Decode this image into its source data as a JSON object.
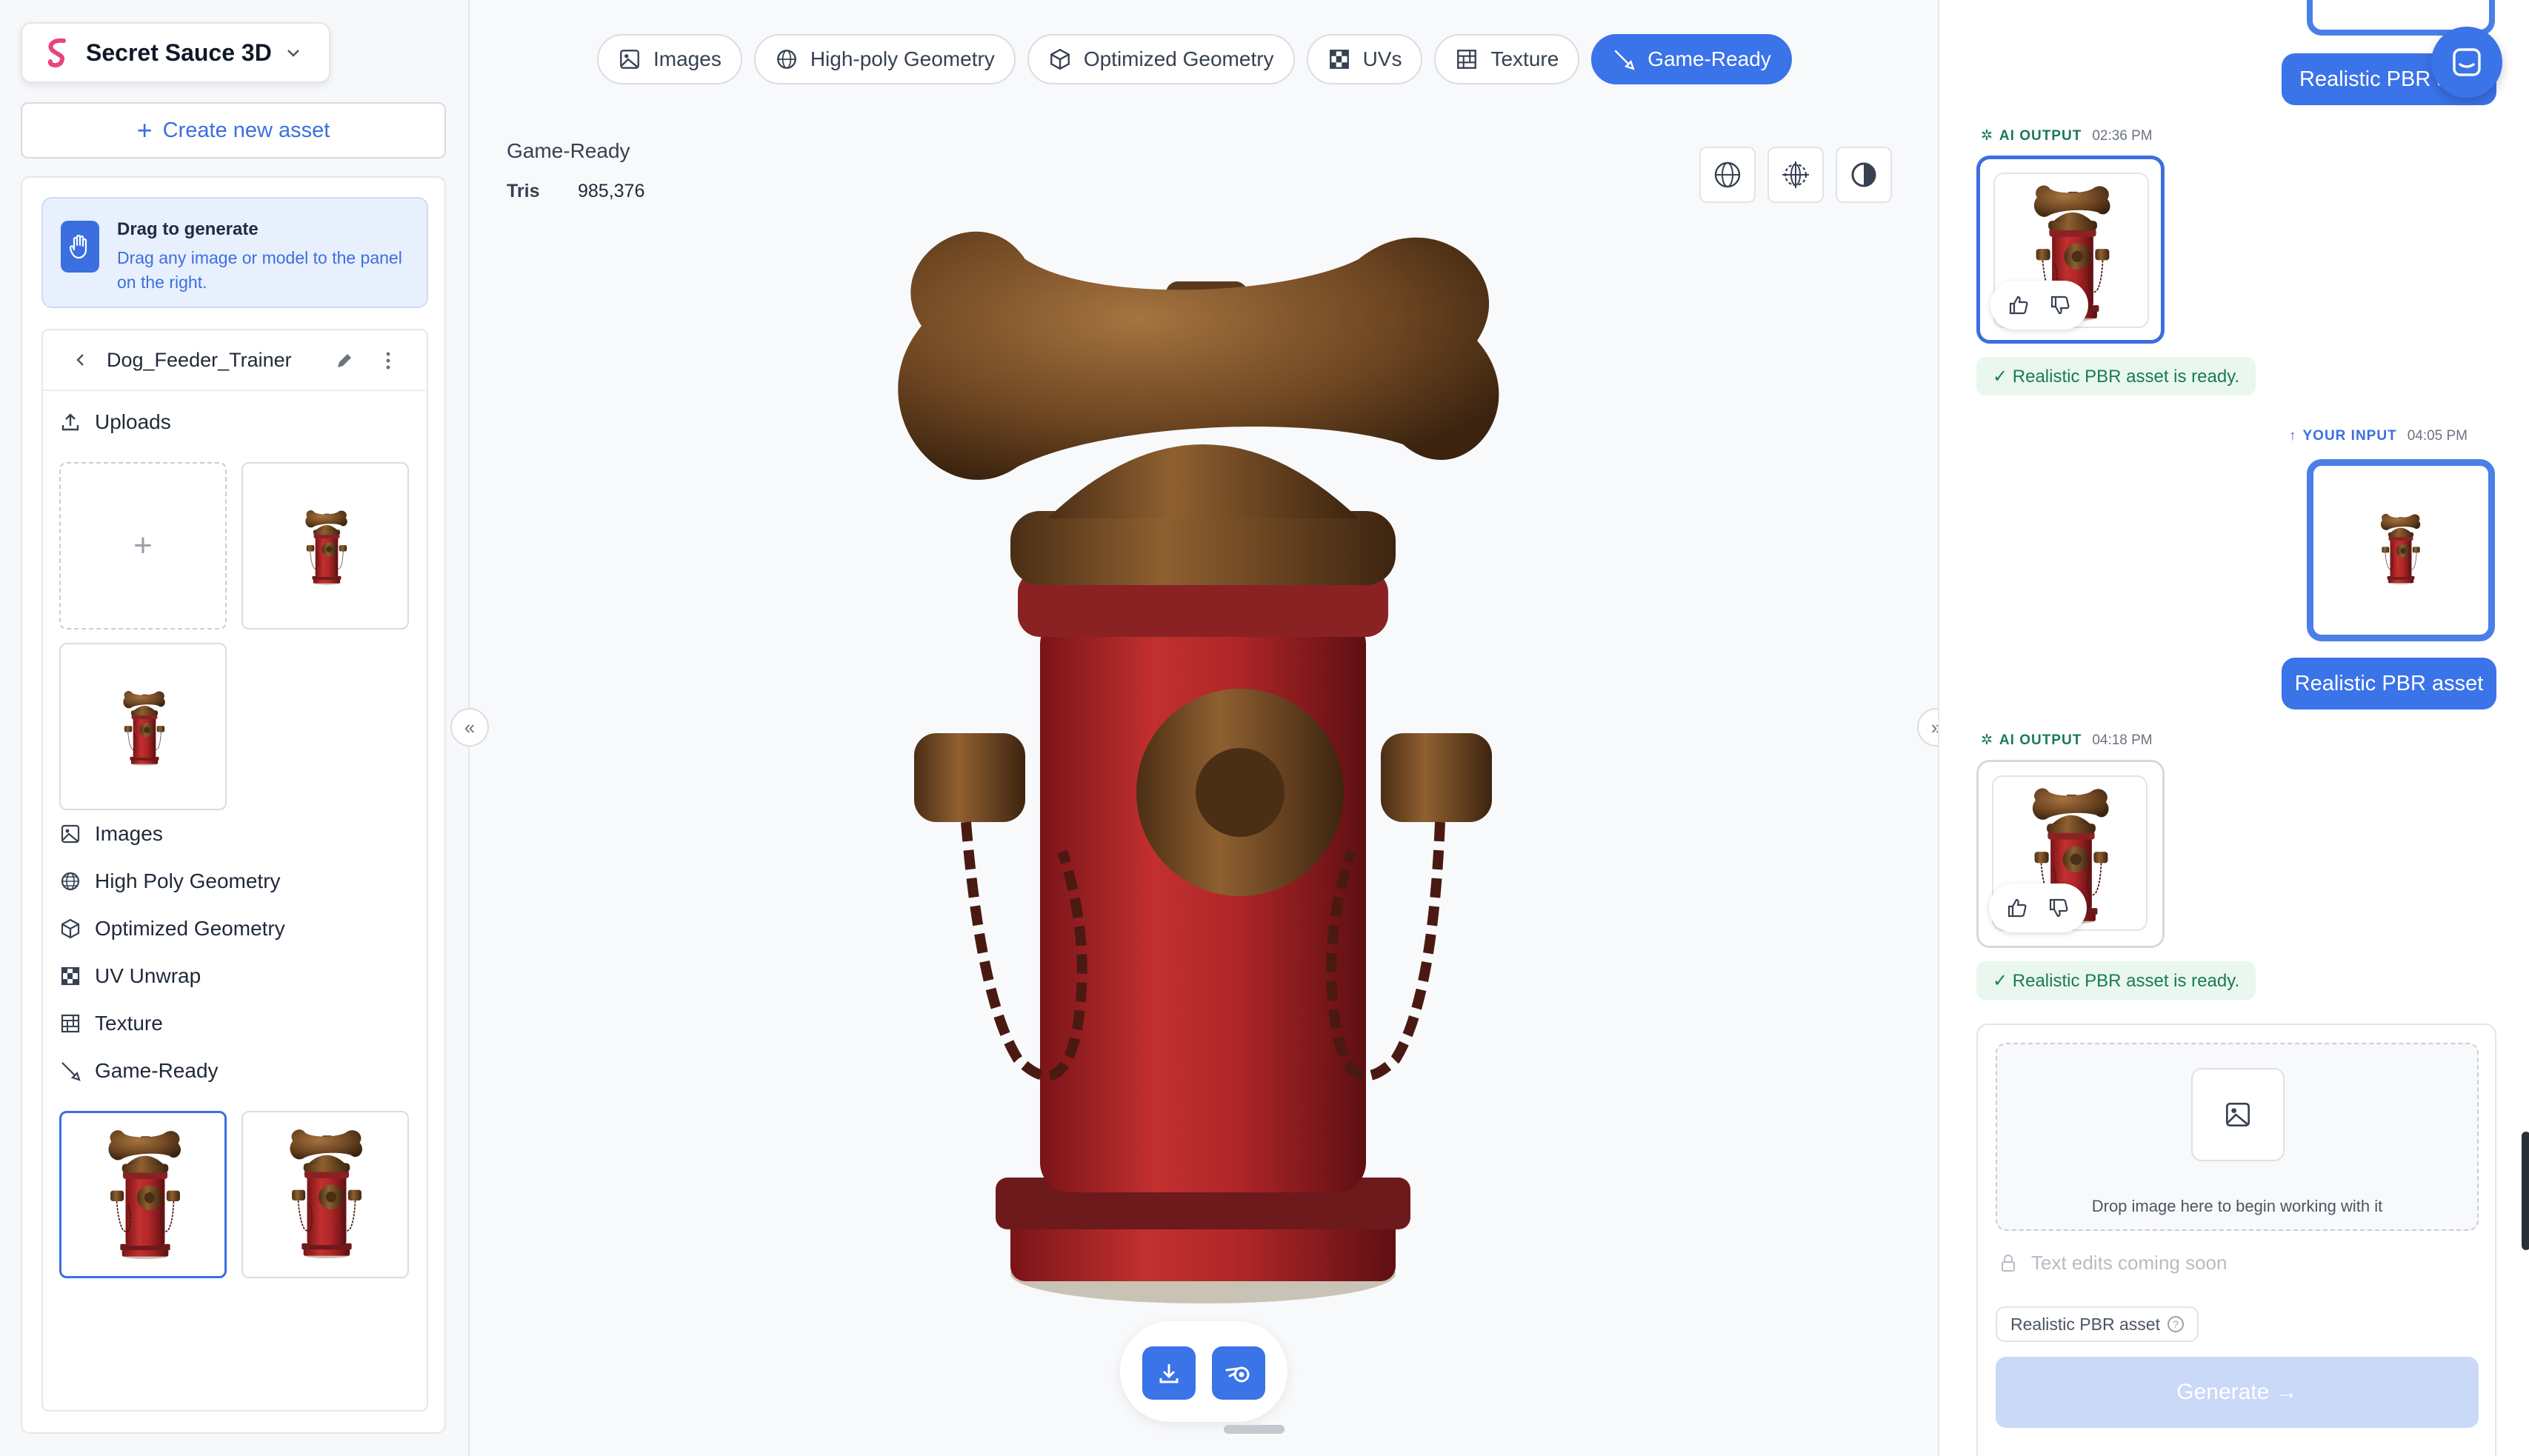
{
  "app": {
    "name": "Secret Sauce 3D"
  },
  "left": {
    "create_label": "Create new asset",
    "drag_tip": {
      "title": "Drag to generate",
      "desc": "Drag any image or model to the panel on the right."
    },
    "project": {
      "name": "Dog_Feeder_Trainer"
    },
    "sections": {
      "uploads": "Uploads",
      "images": "Images",
      "high_poly": "High Poly Geometry",
      "optimized": "Optimized Geometry",
      "uv": "UV Unwrap",
      "texture": "Texture",
      "game_ready": "Game-Ready"
    },
    "upload_add": "+"
  },
  "center": {
    "tabs": [
      {
        "label": "Images",
        "icon": "image-icon"
      },
      {
        "label": "High-poly Geometry",
        "icon": "sphere-icon"
      },
      {
        "label": "Optimized Geometry",
        "icon": "cube-icon"
      },
      {
        "label": "UVs",
        "icon": "checker-icon"
      },
      {
        "label": "Texture",
        "icon": "grid-icon"
      },
      {
        "label": "Game-Ready",
        "icon": "brush-icon",
        "active": true
      }
    ],
    "view_title": "Game-Ready",
    "tris_label": "Tris",
    "tris_value": "985,376",
    "collapse_left": "«",
    "collapse_right": "»"
  },
  "right": {
    "messages": {
      "top_pill": "Realistic PBR a",
      "ai_label": "AI OUTPUT",
      "ai1_time": "02:36 PM",
      "ready1": "✓ Realistic PBR asset is ready.",
      "user_label": "YOUR INPUT",
      "user_time": "04:05 PM",
      "user_pill": "Realistic PBR asset",
      "ai2_time": "04:18 PM",
      "ready2": "✓ Realistic PBR asset is ready."
    },
    "composer": {
      "drop_text": "Drop image here to begin working with it",
      "text_edits": "Text edits coming soon",
      "chip": "Realistic PBR asset",
      "chip_help": "?",
      "generate": "Generate →"
    }
  },
  "colors": {
    "accent": "#3b73e8",
    "success": "#1a7a53",
    "hydrant_red": "#b3262a",
    "bone_brown": "#7a5028"
  }
}
